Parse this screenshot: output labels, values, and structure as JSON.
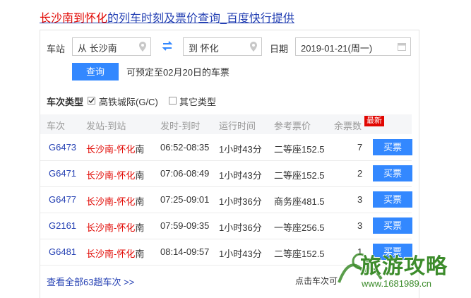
{
  "header": {
    "title_highlight": "长沙南到怀化",
    "title_rest": "的列车时刻及票价查询_百度快行提供"
  },
  "search": {
    "station_label": "车站",
    "from_value": "从 长沙南",
    "to_value": "到 怀化",
    "date_label": "日期",
    "date_value": "2019-01-21(周一)",
    "query_button": "查询",
    "presale_hint": "可预定至02月20日的车票"
  },
  "filter": {
    "label": "车次类型",
    "options": [
      {
        "label": "高铁城际(G/C)",
        "checked": true
      },
      {
        "label": "其它类型",
        "checked": false
      }
    ]
  },
  "table": {
    "columns": [
      "车次",
      "发站-到站",
      "发时-到时",
      "运行时间",
      "参考票价",
      "余票数"
    ],
    "new_badge": "最新",
    "rows": [
      {
        "train": "G6473",
        "from": "长沙南-怀化",
        "to": "南",
        "time": "06:52-08:35",
        "duration": "1小时43分",
        "price": "二等座152.5",
        "remaining": "7",
        "buy": "买票"
      },
      {
        "train": "G6471",
        "from": "长沙南-怀化",
        "to": "南",
        "time": "07:06-08:49",
        "duration": "1小时43分",
        "price": "二等座152.5",
        "remaining": "2",
        "buy": "买票"
      },
      {
        "train": "G6477",
        "from": "长沙南-怀化",
        "to": "南",
        "time": "07:25-09:01",
        "duration": "1小时36分",
        "price": "商务座481.5",
        "remaining": "3",
        "buy": "买票"
      },
      {
        "train": "G2161",
        "from": "长沙南-怀化",
        "to": "南",
        "time": "07:59-09:35",
        "duration": "1小时36分",
        "price": "一等座256.5",
        "remaining": "3",
        "buy": "买票"
      },
      {
        "train": "G6481",
        "from": "长沙南-怀化",
        "to": "南",
        "time": "08:14-09:57",
        "duration": "1小时43分",
        "price": "二等座152.5",
        "remaining": "1",
        "buy": "买票"
      }
    ],
    "more_link": "查看全部63趟车次 >>",
    "footer_hint": "点击车次可"
  },
  "watermark": {
    "line1": "旅游攻略",
    "line2": "www.1681989.cn"
  },
  "colors": {
    "accent": "#3388ff",
    "highlight": "#e10601",
    "link": "#2440b3"
  }
}
